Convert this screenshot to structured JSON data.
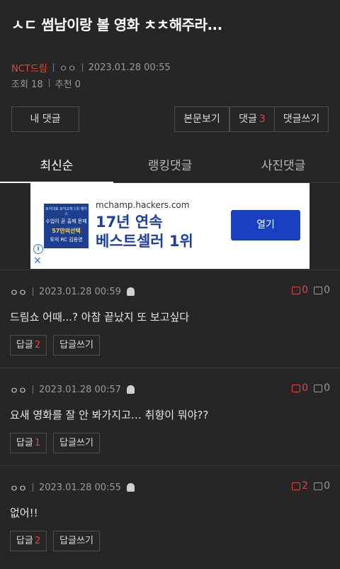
{
  "post": {
    "title": "ㅅㄷ 썸남이랑 볼 영화 ㅊㅊ해주라...",
    "board": "NCT드림",
    "author": "ㅇㅇ",
    "datetime": "2023.01.28 00:55",
    "views_label": "조회 18",
    "recommend_label": "추천 0"
  },
  "actions": {
    "my_comments": "내 댓글",
    "view_body": "본문보기",
    "comments_label": "댓글",
    "comments_count": "3",
    "write_comment": "댓글쓰기"
  },
  "tabs": [
    {
      "label": "최신순",
      "active": true
    },
    {
      "label": "랭킹댓글",
      "active": false
    },
    {
      "label": "사진댓글",
      "active": false
    }
  ],
  "ad": {
    "url": "mchamp.hackers.com",
    "headline_1": "17년 연속",
    "headline_2": "베스트셀러 1위",
    "cta": "열기",
    "book_line1": "토익대표 토익교재 1위 해커스",
    "book_line2": "수업이 곧 출제 문제",
    "book_line3": "57만의선택",
    "book_line4": "토익 RC 김동영",
    "info_glyph": "i",
    "close_glyph": "✕"
  },
  "comments": [
    {
      "author": "ㅇㅇ",
      "datetime": "2023.01.28 00:59",
      "up": "0",
      "down": "0",
      "text": "드림쇼 어때...? 아참 끝났지 또 보고싶다",
      "reply_label": "답글",
      "reply_count": "2",
      "write_reply": "답글쓰기"
    },
    {
      "author": "ㅇㅇ",
      "datetime": "2023.01.28 00:57",
      "up": "0",
      "down": "0",
      "text": "요새 영화를 잘 안 봐가지고… 취향이 뭐야??",
      "reply_label": "답글",
      "reply_count": "1",
      "write_reply": "답글쓰기"
    },
    {
      "author": "ㅇㅇ",
      "datetime": "2023.01.28 00:55",
      "up": "2",
      "down": "0",
      "text": "없어!!",
      "reply_label": "답글",
      "reply_count": "2",
      "write_reply": "답글쓰기"
    }
  ],
  "colors": {
    "background": "#262626",
    "accent_red": "#e0483e",
    "ad_button": "#1a3fc0"
  }
}
